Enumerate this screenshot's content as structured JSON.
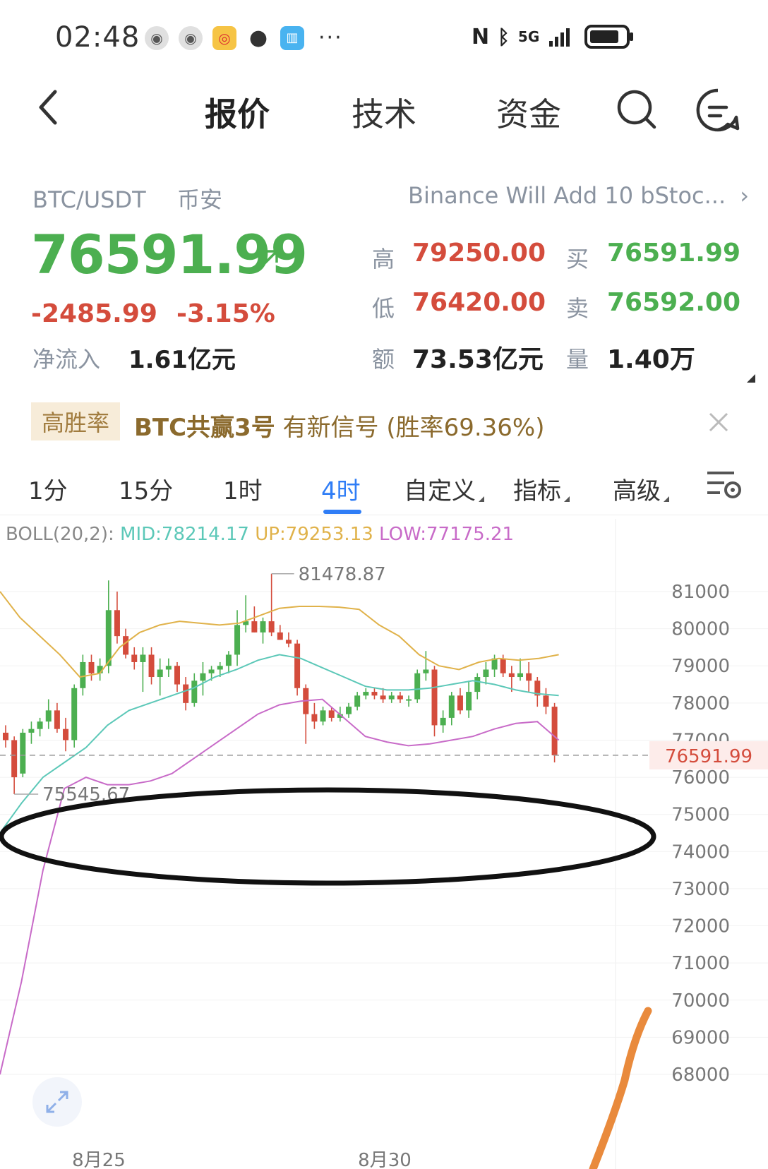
{
  "status_bar": {
    "time": "02:48",
    "dots": "···",
    "network": "5G",
    "icons": [
      "app-icon-1",
      "app-icon-2",
      "weibo-icon",
      "message-icon",
      "book-icon",
      "nfc-icon",
      "bluetooth-icon",
      "signal-icon",
      "battery-icon"
    ]
  },
  "nav": {
    "tabs": [
      "报价",
      "技术",
      "资金"
    ],
    "active_tab": "报价"
  },
  "quote": {
    "pair": "BTC/USDT",
    "exchange": "币安",
    "news": "Binance Will Add 10 bStoc...",
    "price": "76591.99",
    "change": "-2485.99",
    "change_pct": "-3.15%",
    "netflow_label": "净流入",
    "netflow": "1.61亿元",
    "high_label": "高",
    "high": "79250.00",
    "low_label": "低",
    "low": "76420.00",
    "amount_label": "额",
    "amount": "73.53亿元",
    "bid_label": "买",
    "bid": "76591.99",
    "ask_label": "卖",
    "ask": "76592.00",
    "volume_label": "量",
    "volume": "1.40万"
  },
  "signal": {
    "tag": "高胜率",
    "strategy": "BTC共赢3号",
    "text": " 有新信号 (胜率69.36%)"
  },
  "timeframes": {
    "items": [
      "1分",
      "15分",
      "1时",
      "4时",
      "自定义",
      "指标",
      "高级"
    ],
    "active": "4时"
  },
  "indicator": {
    "name": "BOLL(20,2): ",
    "mid": "MID:78214.17",
    "up": "UP:79253.13",
    "low": "LOW:77175.21"
  },
  "colors": {
    "up": "#4caf50",
    "down": "#d44c3c",
    "accent": "#2f7df6",
    "boll_mid": "#5cc8b8",
    "boll_up": "#e0b24a",
    "boll_low": "#c86bc8"
  },
  "chart_data": {
    "type": "candlestick",
    "y_ticks": [
      81000,
      80000,
      79000,
      78000,
      77000,
      76000,
      75000,
      74000,
      73000,
      72000,
      71000,
      70000,
      69000,
      68000
    ],
    "ylim": [
      67500,
      81800
    ],
    "x_labels": [
      "8月25",
      "8月30"
    ],
    "current_price_label": "76591.99",
    "max_marker": "81478.87",
    "min_marker": "75545.67",
    "candles": [
      [
        77200,
        77400,
        76800,
        77000
      ],
      [
        77000,
        77100,
        75545.67,
        76000
      ],
      [
        76100,
        77300,
        76000,
        77200
      ],
      [
        77200,
        77500,
        76900,
        77300
      ],
      [
        77300,
        77600,
        77100,
        77500
      ],
      [
        77500,
        78100,
        77300,
        77800
      ],
      [
        77800,
        78000,
        77200,
        77300
      ],
      [
        77300,
        77600,
        76700,
        77000
      ],
      [
        77000,
        78500,
        76800,
        78400
      ],
      [
        78400,
        79300,
        78200,
        79100
      ],
      [
        79100,
        79300,
        78600,
        78800
      ],
      [
        78800,
        79200,
        78600,
        79000
      ],
      [
        79000,
        81300,
        78800,
        80500
      ],
      [
        80500,
        81000,
        79600,
        79800
      ],
      [
        79800,
        80000,
        79200,
        79300
      ],
      [
        79300,
        79500,
        78900,
        79100
      ],
      [
        79100,
        79500,
        78300,
        79300
      ],
      [
        79300,
        79500,
        78500,
        78700
      ],
      [
        78700,
        79200,
        78200,
        78900
      ],
      [
        78900,
        79200,
        78700,
        79000
      ],
      [
        79000,
        79100,
        78300,
        78500
      ],
      [
        78500,
        78700,
        77800,
        78000
      ],
      [
        78000,
        78800,
        77900,
        78600
      ],
      [
        78600,
        79100,
        78200,
        78800
      ],
      [
        78800,
        79000,
        78600,
        78900
      ],
      [
        78900,
        79100,
        78700,
        79000
      ],
      [
        79000,
        79400,
        78800,
        79300
      ],
      [
        79300,
        80500,
        79000,
        80100
      ],
      [
        80100,
        80900,
        79900,
        80200
      ],
      [
        80200,
        80600,
        79900,
        79900
      ],
      [
        79900,
        80300,
        79600,
        80200
      ],
      [
        80200,
        81478.87,
        79800,
        79900
      ],
      [
        79900,
        80100,
        79700,
        79700
      ],
      [
        79700,
        79900,
        79500,
        79600
      ],
      [
        79600,
        79700,
        78200,
        78400
      ],
      [
        78400,
        78500,
        76900,
        77700
      ],
      [
        77700,
        78000,
        77300,
        77500
      ],
      [
        77500,
        77900,
        77400,
        77800
      ],
      [
        77800,
        77900,
        77500,
        77600
      ],
      [
        77600,
        77900,
        77500,
        77700
      ],
      [
        77700,
        78000,
        77600,
        77900
      ],
      [
        77900,
        78300,
        77800,
        78200
      ],
      [
        78200,
        78400,
        78100,
        78300
      ],
      [
        78300,
        78400,
        78100,
        78200
      ],
      [
        78200,
        78400,
        78000,
        78100
      ],
      [
        78100,
        78300,
        78000,
        78200
      ],
      [
        78200,
        78300,
        78000,
        78100
      ],
      [
        78100,
        78200,
        77900,
        78100
      ],
      [
        78100,
        78900,
        78000,
        78800
      ],
      [
        78800,
        79400,
        78600,
        78900
      ],
      [
        78900,
        79000,
        77100,
        77400
      ],
      [
        77400,
        77800,
        77200,
        77600
      ],
      [
        77600,
        78300,
        77400,
        78200
      ],
      [
        78200,
        78400,
        77700,
        77800
      ],
      [
        77800,
        78600,
        77600,
        78300
      ],
      [
        78300,
        78800,
        78100,
        78700
      ],
      [
        78700,
        79100,
        78500,
        78900
      ],
      [
        78900,
        79300,
        78700,
        79200
      ],
      [
        79200,
        79300,
        78700,
        78800
      ],
      [
        78800,
        79000,
        78300,
        78700
      ],
      [
        78700,
        79200,
        78600,
        78800
      ],
      [
        78800,
        79100,
        78300,
        78600
      ],
      [
        78600,
        78700,
        77900,
        78200
      ],
      [
        78200,
        78400,
        77700,
        77900
      ],
      [
        77900,
        78000,
        76400,
        76591.99
      ]
    ],
    "boll_up": [
      81000,
      80300,
      79800,
      79300,
      78700,
      78800,
      79500,
      79900,
      80100,
      80200,
      80150,
      80100,
      80150,
      80350,
      80550,
      80600,
      80600,
      80580,
      80520,
      80100,
      79800,
      79300,
      79000,
      78900,
      79100,
      79200,
      79150,
      79200,
      79300
    ],
    "boll_mid": [
      74500,
      75300,
      76000,
      76400,
      76800,
      77400,
      77800,
      78000,
      78200,
      78400,
      78700,
      78900,
      79150,
      79300,
      79200,
      78950,
      78700,
      78450,
      78350,
      78350,
      78400,
      78500,
      78600,
      78500,
      78350,
      78250,
      78200
    ],
    "boll_low": [
      68000,
      70500,
      73500,
      75700,
      76000,
      75800,
      75800,
      75900,
      76100,
      76500,
      76900,
      77300,
      77700,
      77950,
      78050,
      78100,
      77600,
      77100,
      76950,
      76850,
      76900,
      77000,
      77100,
      77300,
      77450,
      77500,
      77000
    ]
  }
}
